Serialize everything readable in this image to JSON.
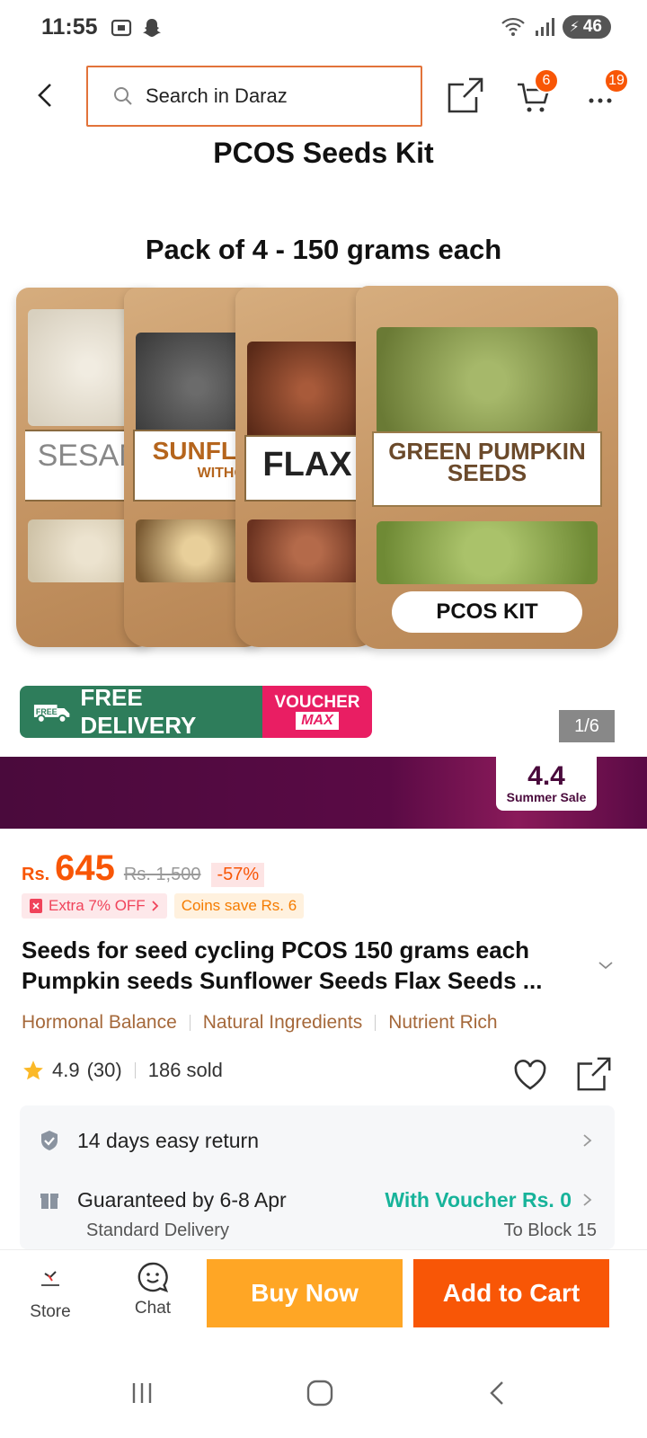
{
  "status_bar": {
    "time": "11:55",
    "battery": "46",
    "icons_left": [
      "screenshot-icon",
      "snapchat-icon"
    ],
    "icons_right": [
      "wifi-icon",
      "signal-icon",
      "battery-icon"
    ]
  },
  "topnav": {
    "search_placeholder": "Search in Daraz",
    "cart_count": "6",
    "more_count": "19"
  },
  "hero": {
    "title": "PCOS Seeds Kit",
    "subtitle": "Pack of 4  -  150 grams each",
    "pouches": [
      {
        "label": "SESAM"
      },
      {
        "label": "SUNFLO",
        "sublabel": "WITHO"
      },
      {
        "label": "FLAX"
      },
      {
        "label": "GREEN PUMPKIN\nSEEDS"
      }
    ],
    "kit_label": "PCOS KIT",
    "free_tag": "FREE",
    "free_delivery": "FREE DELIVERY",
    "voucher_line1": "VOUCHER",
    "voucher_line2": "MAX",
    "page_indicator": "1/6"
  },
  "sale_banner": {
    "number": "4.4",
    "text": "Summer Sale"
  },
  "price": {
    "currency": "Rs.",
    "current": "645",
    "original": "Rs. 1,500",
    "discount": "-57%",
    "extra_off": "Extra 7% OFF",
    "coins": "Coins save Rs. 6"
  },
  "product": {
    "title": "Seeds for seed cycling PCOS 150 grams each Pumpkin seeds Sunflower Seeds Flax Seeds ...",
    "tags": [
      "Hormonal Balance",
      "Natural Ingredients",
      "Nutrient Rich"
    ],
    "rating": "4.9",
    "reviews": "(30)",
    "sold": "186 sold"
  },
  "info": {
    "return_text": "14 days easy return",
    "delivery_text": "Guaranteed by 6-8 Apr",
    "voucher_text": "With Voucher Rs. 0",
    "delivery_type": "Standard Delivery",
    "location": "To Block 15"
  },
  "bottom_bar": {
    "store_label": "Store",
    "chat_label": "Chat",
    "buy_label": "Buy Now",
    "cart_label": "Add to Cart"
  },
  "colors": {
    "brand_orange": "#f85606",
    "buy_yellow": "#ffa625",
    "teal": "#17b39a",
    "sale_purple": "#4a0a3c"
  }
}
